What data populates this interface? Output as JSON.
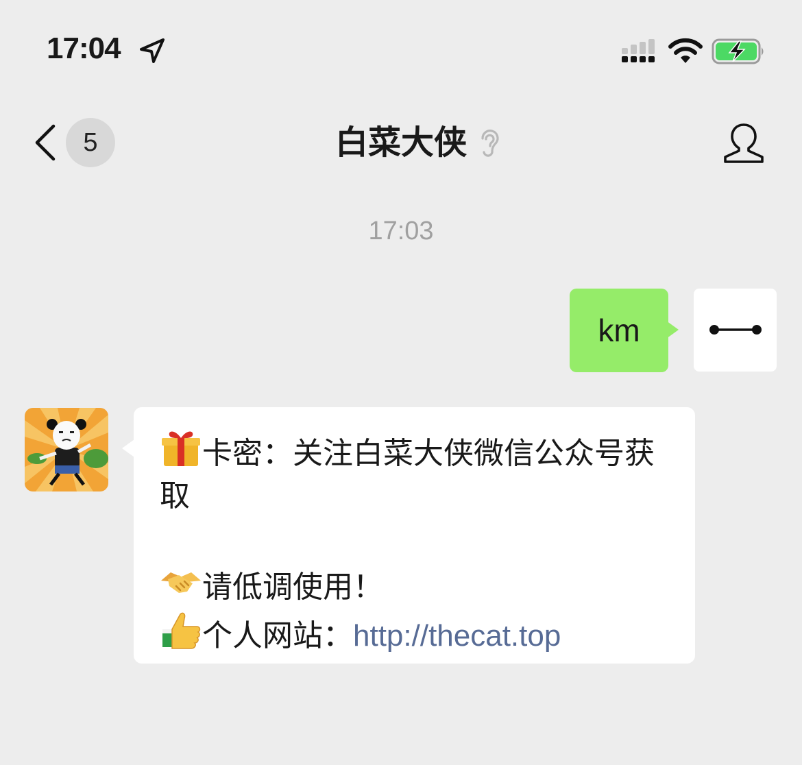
{
  "status_bar": {
    "time": "17:04"
  },
  "nav": {
    "unread_count": "5",
    "title": "白菜大侠"
  },
  "chat": {
    "timestamp": "17:03",
    "outgoing": {
      "text": "km"
    },
    "incoming": {
      "line1": "卡密：关注白菜大侠微信公众号获取",
      "line2": "请低调使用！",
      "line3_label": "个人网站：",
      "line3_link": "http://thecat.top"
    }
  },
  "icons": {
    "location": "location-arrow-icon",
    "signal": "cellular-signal-icon",
    "wifi": "wifi-icon",
    "battery": "battery-charging-icon",
    "back": "chevron-left-icon",
    "ear": "ear-icon",
    "profile": "person-icon",
    "gift": "gift-emoji",
    "handshake": "handshake-emoji",
    "thumbs_up": "thumbs-up-emoji"
  },
  "colors": {
    "background": "#ededed",
    "outgoing_bubble": "#95ec69",
    "incoming_bubble": "#ffffff",
    "link": "#576b95",
    "battery_fill": "#4cd964"
  }
}
